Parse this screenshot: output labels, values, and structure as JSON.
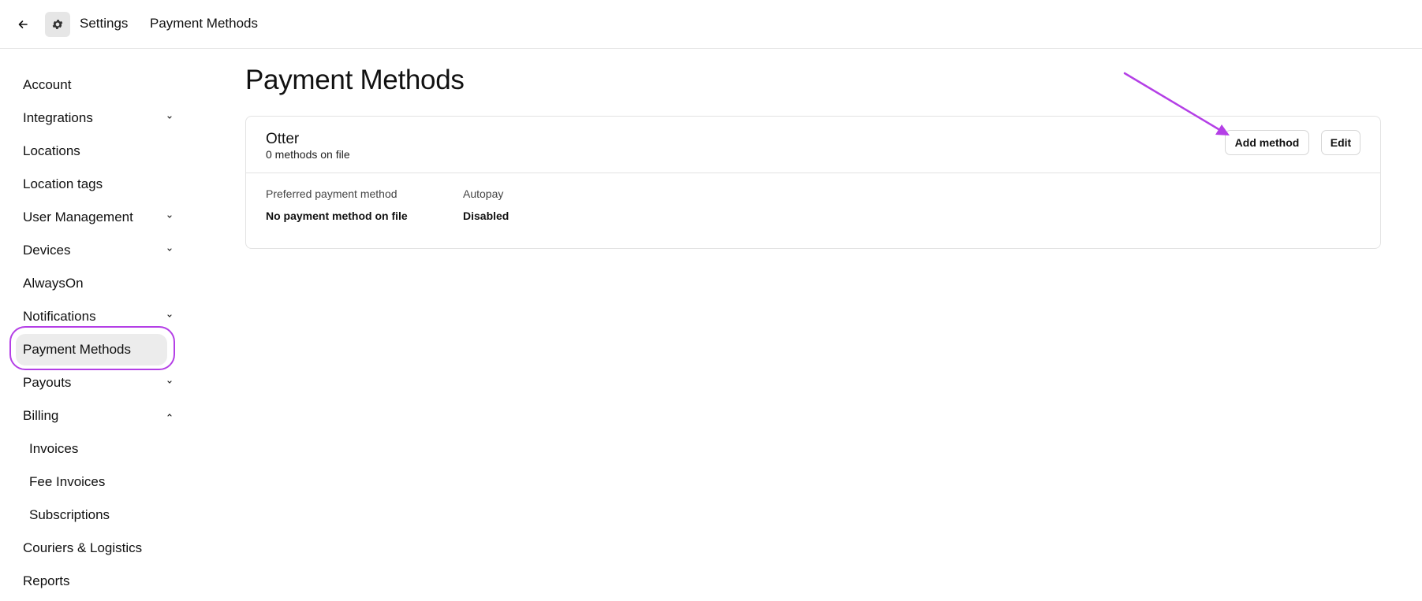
{
  "topbar": {
    "back_icon": "arrow-left-icon",
    "settings_icon": "gear-icon",
    "settings_label": "Settings",
    "current_label": "Payment Methods"
  },
  "sidebar": {
    "items": [
      {
        "label": "Account"
      },
      {
        "label": "Integrations",
        "expandable": true,
        "expanded": false
      },
      {
        "label": "Locations"
      },
      {
        "label": "Location tags"
      },
      {
        "label": "User Management",
        "expandable": true,
        "expanded": false
      },
      {
        "label": "Devices",
        "expandable": true,
        "expanded": false
      },
      {
        "label": "AlwaysOn"
      },
      {
        "label": "Notifications",
        "expandable": true,
        "expanded": false
      },
      {
        "label": "Payment Methods",
        "active": true
      },
      {
        "label": "Payouts",
        "expandable": true,
        "expanded": false
      },
      {
        "label": "Billing",
        "expandable": true,
        "expanded": true
      },
      {
        "label": "Invoices",
        "sub": true
      },
      {
        "label": "Fee Invoices",
        "sub": true
      },
      {
        "label": "Subscriptions",
        "sub": true
      },
      {
        "label": "Couriers & Logistics"
      },
      {
        "label": "Reports"
      }
    ]
  },
  "main": {
    "title": "Payment Methods",
    "card": {
      "name": "Otter",
      "count": "0 methods on file",
      "add_button": "Add method",
      "edit_button": "Edit",
      "fields": [
        {
          "label": "Preferred payment method",
          "value": "No payment method on file"
        },
        {
          "label": "Autopay",
          "value": "Disabled"
        }
      ]
    }
  },
  "colors": {
    "annotation": "#b43fe6",
    "active_bg": "#ececec",
    "border": "#e3e3e3"
  }
}
